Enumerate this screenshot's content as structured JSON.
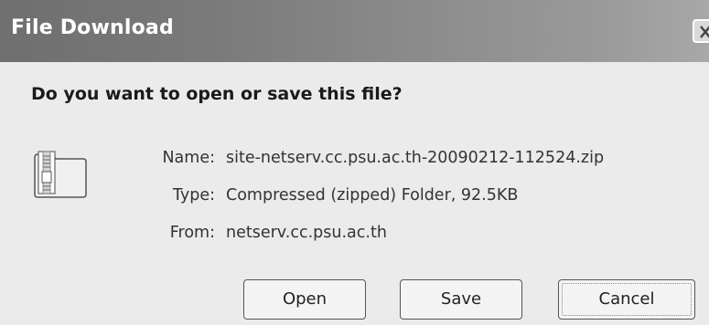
{
  "window": {
    "title": "File Download",
    "close_icon": "close-icon"
  },
  "dialog": {
    "question": "Do you want to open or save this file?",
    "file_icon": "zip-folder-icon",
    "fields": {
      "name_label": "Name:",
      "name_value": "site-netserv.cc.psu.ac.th-20090212-112524.zip",
      "type_label": "Type:",
      "type_value": "Compressed (zipped) Folder, 92.5KB",
      "from_label": "From:",
      "from_value": "netserv.cc.psu.ac.th"
    }
  },
  "buttons": {
    "open_label": "Open",
    "save_label": "Save",
    "cancel_label": "Cancel"
  }
}
